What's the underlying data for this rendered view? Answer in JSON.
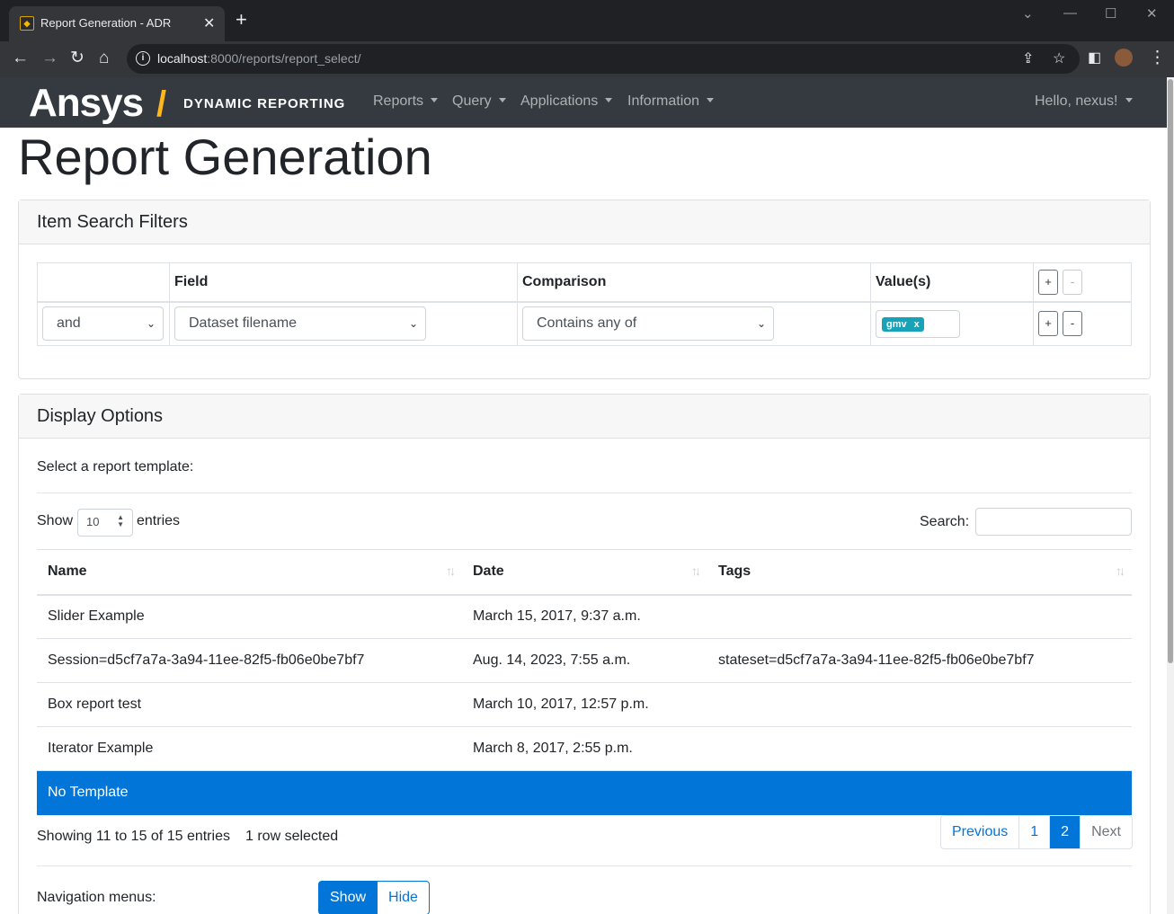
{
  "browser": {
    "tab_title": "Report Generation - ADR",
    "url_host": "localhost",
    "url_path": ":8000/reports/report_select/"
  },
  "navbar": {
    "logo": "Ansys",
    "logo_slash": "/",
    "subtitle": "DYNAMIC REPORTING",
    "menus": [
      "Reports",
      "Query",
      "Applications",
      "Information"
    ],
    "user": "Hello, nexus!"
  },
  "page_title": "Report Generation",
  "filters": {
    "title": "Item Search Filters",
    "headers": [
      "",
      "Field",
      "Comparison",
      "Value(s)"
    ],
    "row": {
      "logic": "and",
      "field": "Dataset filename",
      "comparison": "Contains any of",
      "value_tag": "gmv",
      "tag_remove": "x"
    },
    "add_label": "+",
    "remove_label": "-"
  },
  "display": {
    "title": "Display Options",
    "select_label": "Select a report template:",
    "show_label": "Show",
    "page_length": "10",
    "entries_label": "entries",
    "search_label": "Search:",
    "columns": [
      "Name",
      "Date",
      "Tags"
    ],
    "rows": [
      {
        "name": "Slider Example",
        "date": "March 15, 2017, 9:37 a.m.",
        "tags": ""
      },
      {
        "name": "Session=d5cf7a7a-3a94-11ee-82f5-fb06e0be7bf7",
        "date": "Aug. 14, 2023, 7:55 a.m.",
        "tags": "stateset=d5cf7a7a-3a94-11ee-82f5-fb06e0be7bf7"
      },
      {
        "name": "Box report test",
        "date": "March 10, 2017, 12:57 p.m.",
        "tags": ""
      },
      {
        "name": "Iterator Example",
        "date": "March 8, 2017, 2:55 p.m.",
        "tags": ""
      },
      {
        "name": "No Template",
        "date": "",
        "tags": ""
      }
    ],
    "info": "Showing 11 to 15 of 15 entries",
    "selected_info": "1 row selected",
    "pager": {
      "previous": "Previous",
      "page1": "1",
      "page2": "2",
      "next": "Next"
    },
    "nav_menus_label": "Navigation menus:",
    "show_btn": "Show",
    "hide_btn": "Hide"
  },
  "colors": {
    "primary": "#0275d8",
    "navbar": "#343a40",
    "brand_accent": "#ffb71b",
    "tag": "#17a2b8"
  }
}
